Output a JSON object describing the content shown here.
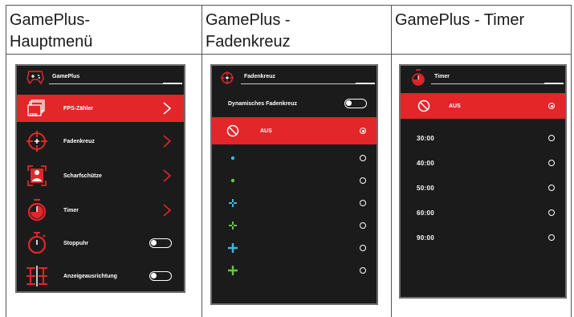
{
  "columns": [
    {
      "heading_line1": "GamePlus-",
      "heading_line2": "Hauptmenü"
    },
    {
      "heading_line1": "GamePlus -",
      "heading_line2": "Fadenkreuz"
    },
    {
      "heading_line1": "GamePlus - Timer",
      "heading_line2": ""
    }
  ],
  "main_menu": {
    "title": "GamePlus",
    "items": [
      {
        "label": "FPS-Zähler",
        "icon": "fps-counter-icon",
        "control": "chevron",
        "selected": true
      },
      {
        "label": "Fadenkreuz",
        "icon": "crosshair-icon",
        "control": "chevron",
        "selected": false
      },
      {
        "label": "Scharfschütze",
        "icon": "sniper-icon",
        "control": "chevron",
        "selected": false
      },
      {
        "label": "Timer",
        "icon": "timer-icon",
        "control": "chevron",
        "selected": false
      },
      {
        "label": "Stoppuhr",
        "icon": "stopwatch-icon",
        "control": "toggle",
        "selected": false
      },
      {
        "label": "Anzeigeausrichtung",
        "icon": "display-alignment-icon",
        "control": "toggle",
        "selected": false
      }
    ],
    "fps_icon_text": "FPS"
  },
  "crosshair_menu": {
    "title": "Fadenkreuz",
    "dynamic_label": "Dynamisches Fadenkreuz",
    "off_label": "AUS",
    "options": [
      {
        "icon": "none-icon",
        "selected": true
      },
      {
        "icon": "dot-cyan-icon",
        "selected": false
      },
      {
        "icon": "dot-green-icon",
        "selected": false
      },
      {
        "icon": "cross-small-cyan-icon",
        "selected": false
      },
      {
        "icon": "cross-small-green-icon",
        "selected": false
      },
      {
        "icon": "cross-large-cyan-icon",
        "selected": false
      },
      {
        "icon": "cross-large-green-icon",
        "selected": false
      }
    ]
  },
  "timer_menu": {
    "title": "Timer",
    "off_label": "AUS",
    "times": [
      "30:00",
      "40:00",
      "50:00",
      "60:00",
      "90:00"
    ]
  },
  "colors": {
    "accent_red": "#e2262a",
    "screen_bg": "#1b1b1b",
    "cyan": "#3fb8d8",
    "green": "#6cc04a"
  }
}
